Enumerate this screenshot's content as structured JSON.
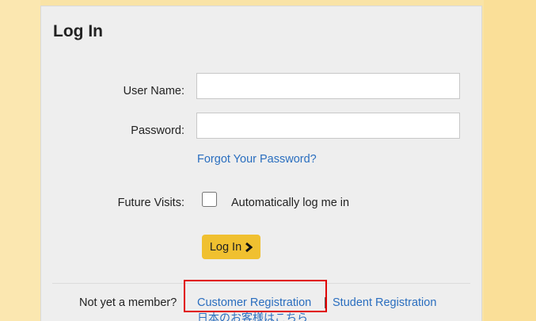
{
  "login": {
    "title": "Log In",
    "username_label": "User Name:",
    "username_value": "",
    "password_label": "Password:",
    "password_value": "",
    "forgot_password": "Forgot Your Password?",
    "future_visits_label": "Future Visits:",
    "auto_login_label": "Automatically log me in",
    "auto_login_checked": false,
    "submit_label": "Log In"
  },
  "registration": {
    "prompt": "Not yet a member?",
    "customer_link": "Customer Registration",
    "separator": "|",
    "student_link": "Student Registration",
    "japanese_link": "日本のお客様はこちら"
  },
  "colors": {
    "page_background": "#f9e3a6",
    "panel_background": "#eeeeee",
    "link": "#2a6ebf",
    "button": "#f0c030",
    "highlight": "#e00000"
  },
  "icons": {
    "button_icon": "chevron-right-icon"
  }
}
